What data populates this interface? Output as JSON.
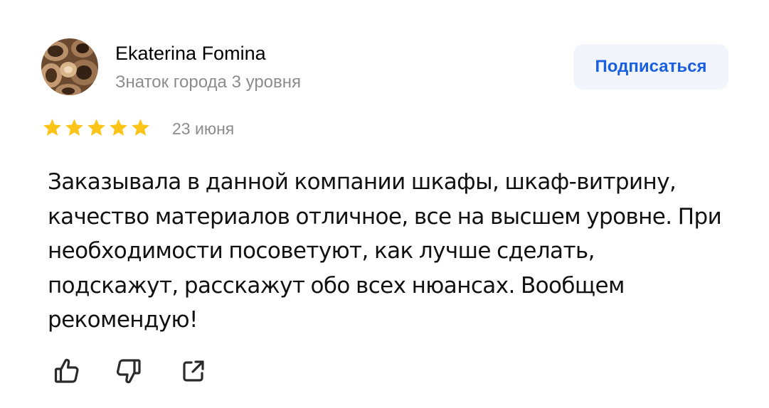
{
  "author": {
    "name": "Ekaterina Fomina",
    "level": "Знаток города 3 уровня",
    "avatar_icon": "walnuts-photo-avatar"
  },
  "subscribe": {
    "label": "Подписаться"
  },
  "review": {
    "rating": 5,
    "rating_max": 5,
    "date": "23 июня",
    "text": "Заказывала в данной компании шкафы, шкаф-витрину, качество материалов отличное, все на высшем уровне. При необходимости посоветуют, как лучше сделать, подскажут, расскажут обо всех нюансах. Вообщем рекомендую!"
  },
  "actions": [
    {
      "icon": "thumbs-up-icon"
    },
    {
      "icon": "thumbs-down-icon"
    },
    {
      "icon": "share-icon"
    }
  ],
  "colors": {
    "accent": "#1a5fe0",
    "button_bg": "#f2f5fb",
    "star": "#fcc419",
    "muted_text": "#8c8c8c"
  }
}
